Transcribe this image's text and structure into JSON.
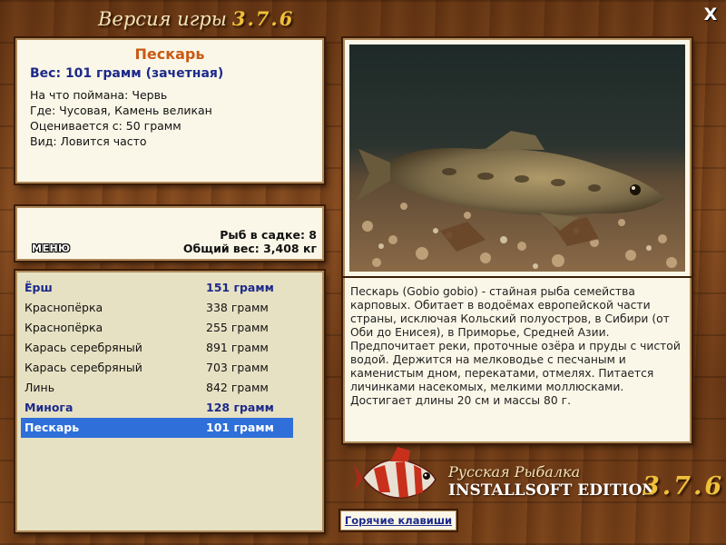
{
  "header": {
    "title": "Версия игры",
    "version": "3.7.6",
    "close_label": "X"
  },
  "fish": {
    "name": "Пескарь",
    "weight": "Вес: 101 грамм (зачетная)",
    "lines": [
      "На что поймана: Червь",
      "Где: Чусовая, Камень великан",
      "Оценивается с: 50 грамм",
      "Вид: Ловится часто"
    ]
  },
  "stats": {
    "menu_label": "МЕНЮ",
    "count": "Рыб в садке: 8",
    "total": "Общий вес: 3,408 кг"
  },
  "catch": [
    {
      "name": "Ёрш",
      "weight": "151 грамм",
      "style": "bold"
    },
    {
      "name": "Краснопёрка",
      "weight": "338 грамм",
      "style": "normal"
    },
    {
      "name": "Краснопёрка",
      "weight": "255 грамм",
      "style": "normal"
    },
    {
      "name": "Карась серебряный",
      "weight": "891 грамм",
      "style": "normal"
    },
    {
      "name": "Карась серебряный",
      "weight": "703 грамм",
      "style": "normal"
    },
    {
      "name": "Линь",
      "weight": "842 грамм",
      "style": "normal"
    },
    {
      "name": "Минога",
      "weight": "128 грамм",
      "style": "bold"
    },
    {
      "name": "Пескарь",
      "weight": "101 грамм",
      "style": "selected"
    }
  ],
  "description": "Пескарь (Gobio gobio) - стайная рыба семейства карповых. Обитает в водоёмах европейской части страны, исключая Кольский полуостров, в Сибири (от Оби до Енисея), в Приморье, Средней Азии. Предпочитает реки, проточные озёра и пруды с чистой водой. Держится на мелководье с песчаным и каменистым дном, перекатами, отмелях. Питается личинками насекомых, мелкими моллюсками. Достигает длины 20 см и массы 80 г.",
  "logo": {
    "line1": "Русская Рыбалка",
    "line2": "INSTALLSOFT EDITION",
    "version": "3.7.6",
    "icon": "fish-logo-icon"
  },
  "hotkeys_label": "Горячие клавиши",
  "colors": {
    "accent_name": "#c85a14",
    "weight_blue": "#1c2a8a",
    "selected_row": "#2e6fd9",
    "version_gold": "#f0c03a"
  }
}
